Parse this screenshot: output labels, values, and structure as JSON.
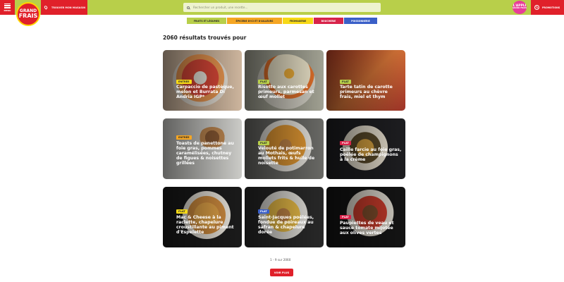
{
  "header": {
    "menu_label": "MENU",
    "logo_line1": "GRAND",
    "logo_line2": "FRAIS",
    "store_link": "TROUVER MON MAGASIN",
    "search_placeholder": "Rechercher un produit, une recette...",
    "appli_line1": "L'APPLI",
    "appli_line2": "GRAND FRAIS",
    "promo_label": "PROMOTIONS"
  },
  "categories": [
    {
      "label": "FRUITS ET LÉGUMES",
      "color": "#b8cf4a"
    },
    {
      "label": "ÉPICERIE D'ICI ET D'AILLEURS",
      "color": "#f5a623"
    },
    {
      "label": "FROMAGERIE",
      "color": "#f7d917"
    },
    {
      "label": "BOUCHERIE",
      "color": "#d8234a"
    },
    {
      "label": "POISSONNERIE",
      "color": "#3a5fc8"
    }
  ],
  "results": {
    "title": "2060 résultats trouvés pour",
    "pager": "1 - 9 sur 2060",
    "more_button": "VOIR PLUS"
  },
  "cards": [
    {
      "tag": "ENTRÉE",
      "tag_color": "#f7d917",
      "title": "Carpaccio de pastèque, melon et Burrata Di Andria IGP*"
    },
    {
      "tag": "PLAT",
      "tag_color": "#b8cf4a",
      "title": "Risotto aux carottes primeurs, parmesan et œuf mollet"
    },
    {
      "tag": "PLAT",
      "tag_color": "#b8cf4a",
      "title": "Tarte tatin de carotte primeurs au chèvre frais, miel et thym"
    },
    {
      "tag": "ENTRÉE",
      "tag_color": "#f5a623",
      "title": "Toasts de panettone au foie gras, pommes caramélisées, chutney de figues & noisettes grillées"
    },
    {
      "tag": "PLAT",
      "tag_color": "#b8cf4a",
      "title": "Velouté de potimarron au Mothais, œufs mollets frits & huile de noisette"
    },
    {
      "tag": "PLAT",
      "tag_color": "#d8234a",
      "title": "Caille farcie au foie gras, poêlée de champignons à la crème"
    },
    {
      "tag": "PLAT",
      "tag_color": "#f7d917",
      "title": "Mac & Cheese à la raclette, chapelure croustillante au piment d'Espelette"
    },
    {
      "tag": "PLAT",
      "tag_color": "#3a5fc8",
      "title": "Saint-Jacques poêlées, fondue de poireaux au safran & chapelure dorée"
    },
    {
      "tag": "PLAT",
      "tag_color": "#d8234a",
      "title": "Paupiettes de veau et sauce tomate mijotée aux olives vertes"
    }
  ]
}
